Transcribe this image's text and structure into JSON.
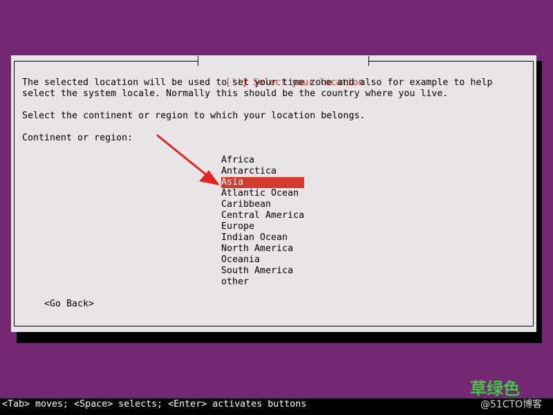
{
  "dialog": {
    "title": "[!!] Select your location",
    "description_line1": "The selected location will be used to set your time zone and also for example to help",
    "description_line2": "select the system locale. Normally this should be the country where you live.",
    "instruction": "Select the continent or region to which your location belongs.",
    "field_label": "Continent or region:",
    "options": [
      "Africa",
      "Antarctica",
      "Asia",
      "Atlantic Ocean",
      "Caribbean",
      "Central America",
      "Europe",
      "Indian Ocean",
      "North America",
      "Oceania",
      "South America",
      "other"
    ],
    "selected_option": "Asia",
    "go_back_label": "<Go Back>"
  },
  "status_bar": {
    "hint": "<Tab> moves; <Space> selects; <Enter> activates buttons"
  },
  "watermark": {
    "chinese_text": "草绿色",
    "site_text": "@51CTO博客"
  },
  "colors": {
    "background": "#722872",
    "dialog": "#e9e5e8",
    "accent": "#d43b2c",
    "watermark_green": "#46c24a"
  },
  "icons": {
    "annotation_arrow": "red-arrow-icon"
  }
}
